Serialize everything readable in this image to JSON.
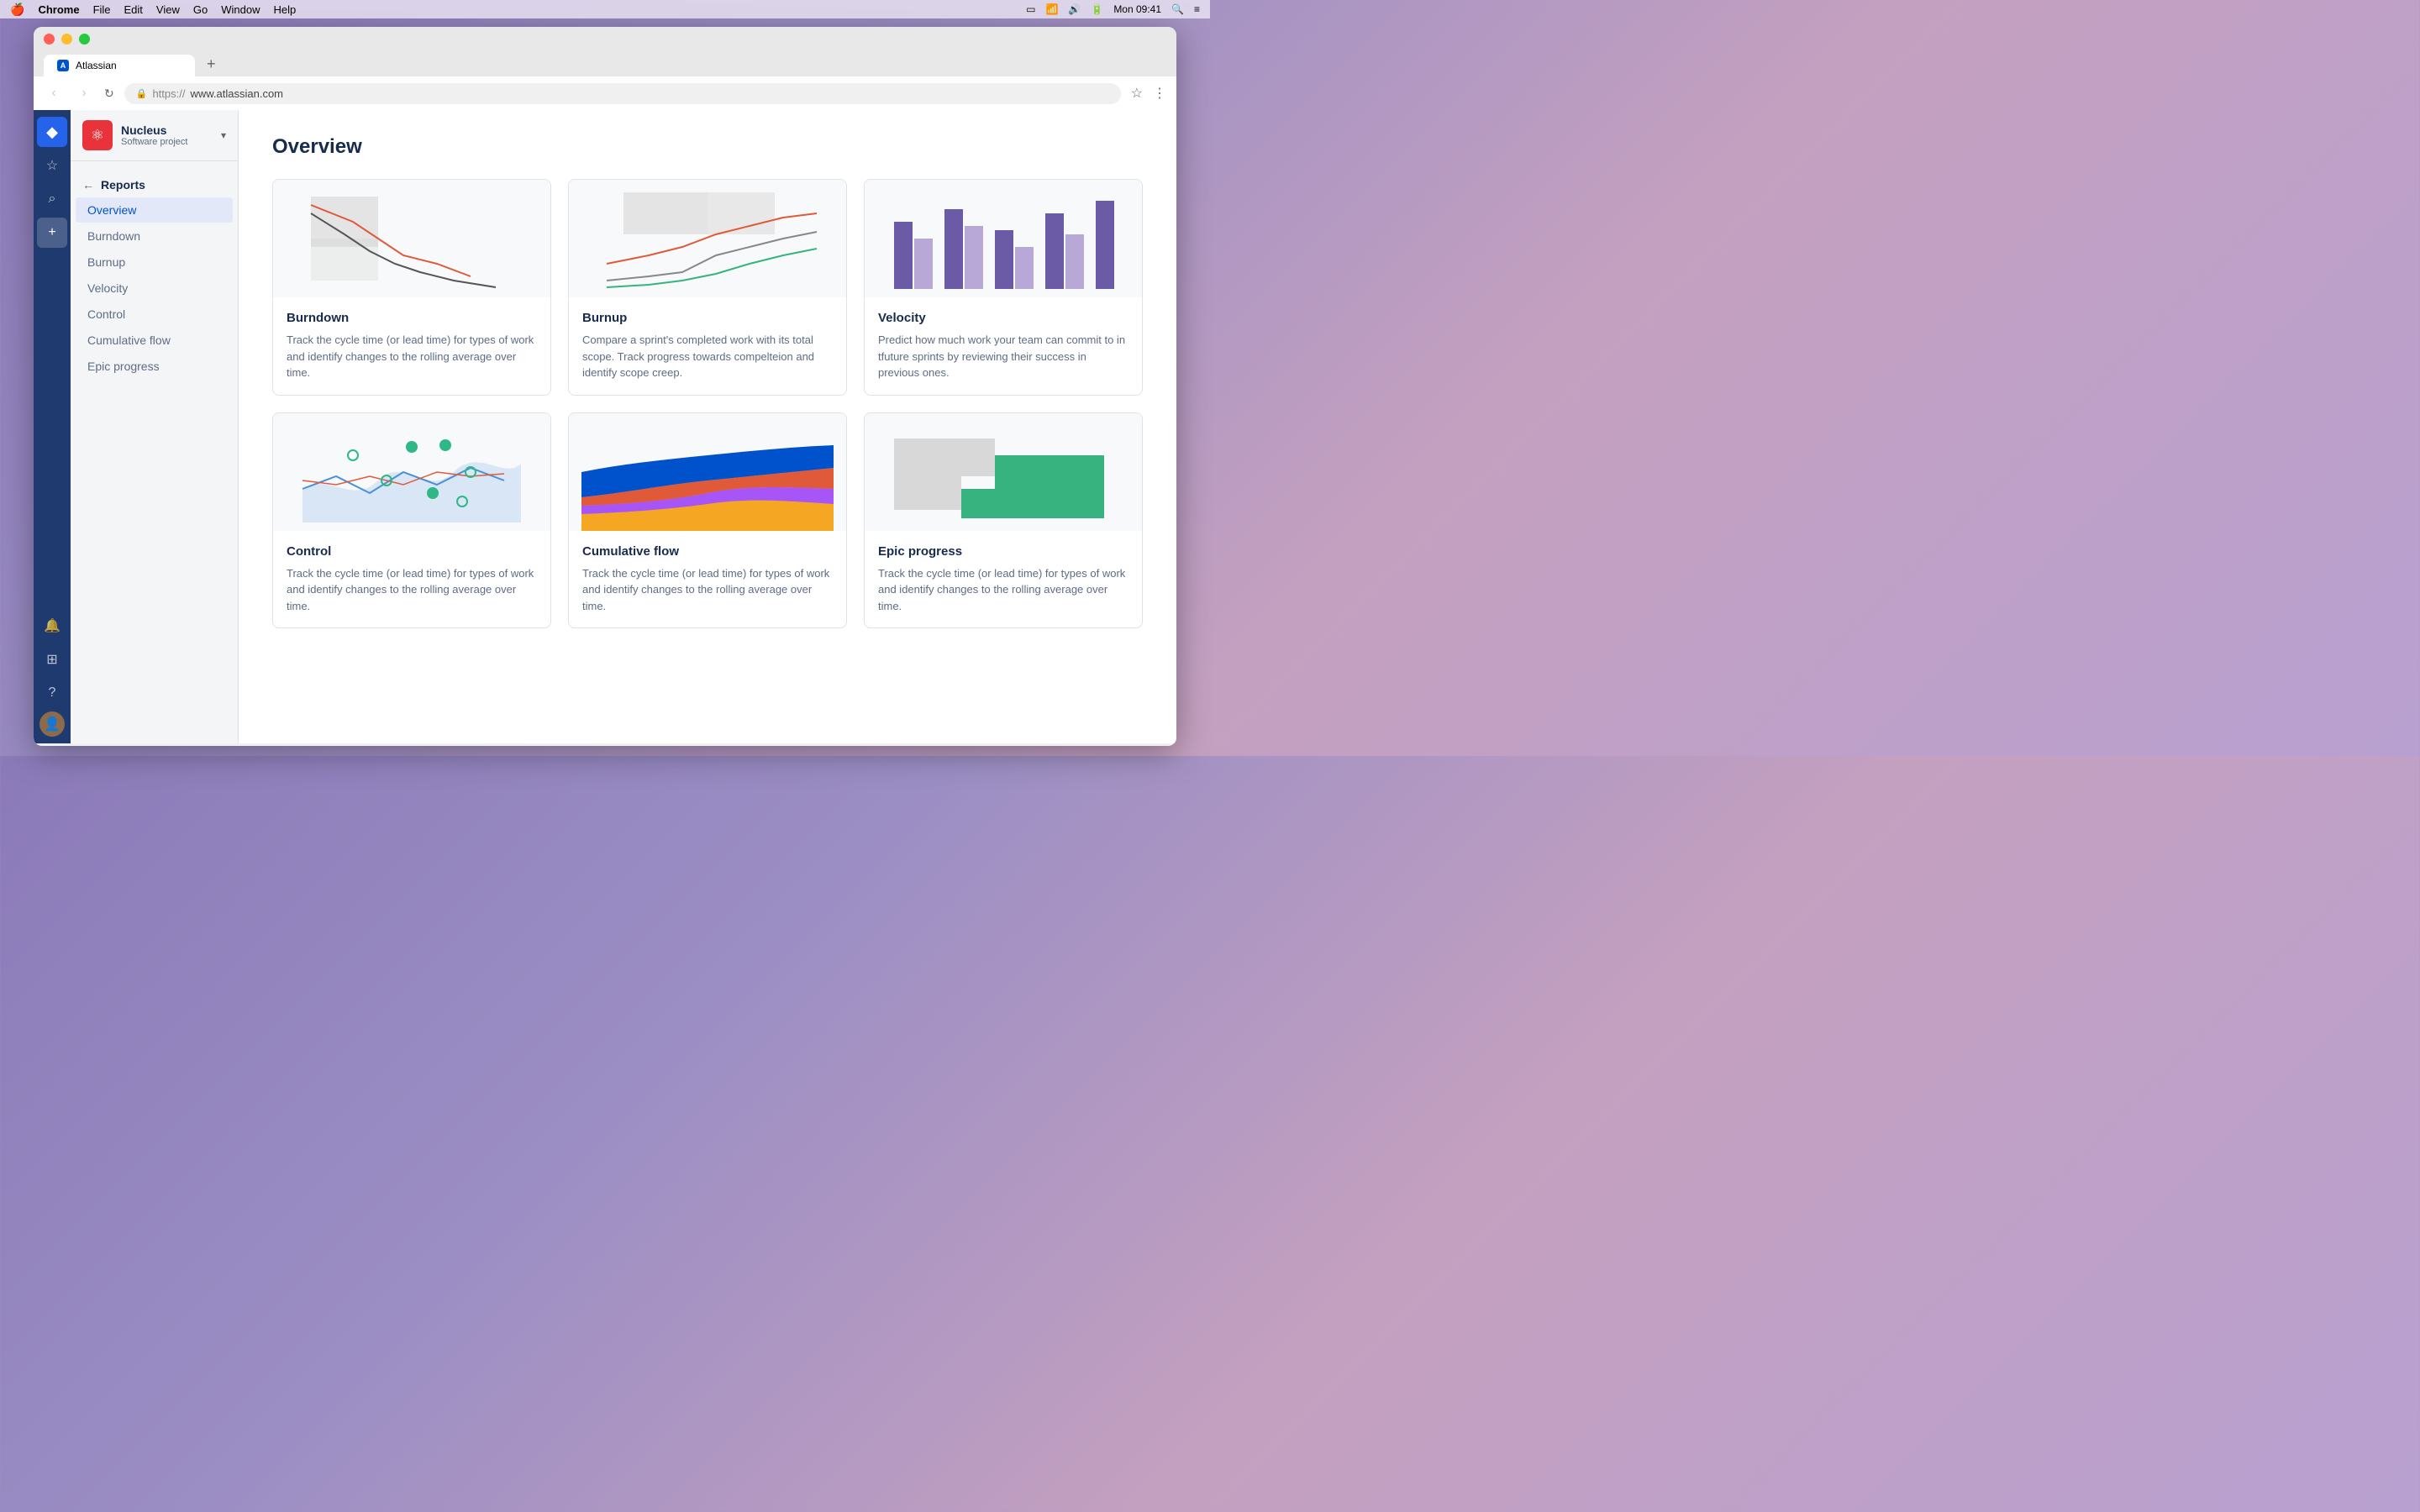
{
  "menubar": {
    "apple": "🍎",
    "items": [
      "Chrome",
      "File",
      "Edit",
      "View",
      "Go",
      "Window",
      "Help"
    ],
    "time": "Mon 09:41"
  },
  "browser": {
    "tab_title": "Atlassian",
    "url_protocol": "https://",
    "url_host": "www.atlassian.com",
    "new_tab_label": "+"
  },
  "sidebar": {
    "project_name": "Nucleus",
    "project_type": "Software project",
    "back_label": "Reports",
    "nav_items": [
      {
        "id": "overview",
        "label": "Overview",
        "active": true
      },
      {
        "id": "burndown",
        "label": "Burndown",
        "active": false
      },
      {
        "id": "burnup",
        "label": "Burnup",
        "active": false
      },
      {
        "id": "velocity",
        "label": "Velocity",
        "active": false
      },
      {
        "id": "control",
        "label": "Control",
        "active": false
      },
      {
        "id": "cumulative-flow",
        "label": "Cumulative flow",
        "active": false
      },
      {
        "id": "epic-progress",
        "label": "Epic progress",
        "active": false
      }
    ]
  },
  "main": {
    "title": "Overview",
    "cards": [
      {
        "id": "burndown",
        "title": "Burndown",
        "desc": "Track the cycle time (or lead time) for types of work and identify changes to the rolling average over time.",
        "chart_type": "burndown"
      },
      {
        "id": "burnup",
        "title": "Burnup",
        "desc": "Compare a sprint's completed work with its total scope. Track progress towards compelteion and identify scope creep.",
        "chart_type": "burnup"
      },
      {
        "id": "velocity",
        "title": "Velocity",
        "desc": "Predict how much work your team can commit to in tfuture sprints by reviewing their success in previous ones.",
        "chart_type": "velocity"
      },
      {
        "id": "control",
        "title": "Control",
        "desc": "Track the cycle time (or lead time) for types of work and identify changes to the rolling average over time.",
        "chart_type": "control"
      },
      {
        "id": "cumulative-flow",
        "title": "Cumulative flow",
        "desc": "Track the cycle time (or lead time) for types of work and identify changes to the rolling average over time.",
        "chart_type": "cumulative"
      },
      {
        "id": "epic-progress",
        "title": "Epic progress",
        "desc": "Track the cycle time (or lead time) for types of work and identify changes to the rolling average over time.",
        "chart_type": "epic"
      }
    ]
  },
  "icons": {
    "back_arrow": "←",
    "diamond": "◆",
    "star": "☆",
    "search": "🔍",
    "plus": "+",
    "bell": "🔔",
    "grid": "⊞",
    "help": "?",
    "chevron_down": "▾",
    "lock": "🔒",
    "bookmark": "☆",
    "more": "⋮",
    "nav_back": "‹",
    "nav_forward": "›",
    "refresh": "↻"
  }
}
